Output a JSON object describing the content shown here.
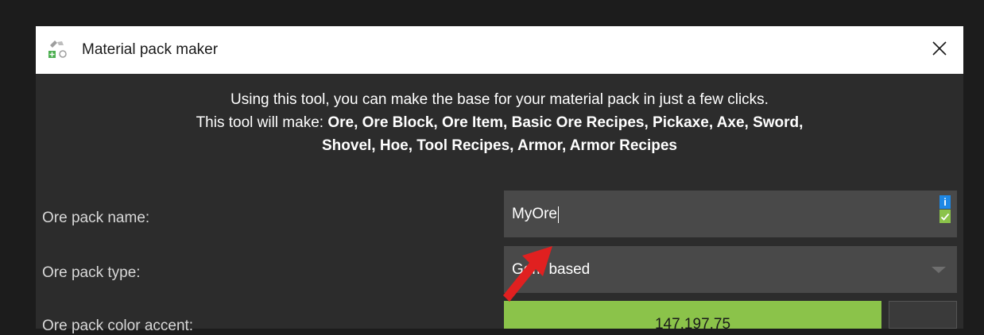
{
  "window": {
    "title": "Material pack maker"
  },
  "intro": {
    "line1": "Using this tool, you can make the base for your material pack in just a few clicks.",
    "line2_prefix": "This tool will make: ",
    "line2_bold": "Ore, Ore Block, Ore Item, Basic Ore Recipes, Pickaxe, Axe, Sword,",
    "line3_bold": "Shovel, Hoe, Tool Recipes, Armor, Armor Recipes"
  },
  "form": {
    "name": {
      "label": "Ore pack name:",
      "value": "MyOre"
    },
    "type": {
      "label": "Ore pack type:",
      "value": "Gem based"
    },
    "color": {
      "label": "Ore pack color accent:",
      "value": "147,197,75",
      "swatch": "#8bc34a"
    }
  },
  "badges": {
    "info": "i"
  },
  "icons": {
    "app": "material-pack-icon",
    "close": "close-icon",
    "info": "info-icon",
    "check": "check-icon",
    "dropdown": "chevron-down-icon",
    "annotation": "red-arrow-icon"
  },
  "colors": {
    "background": "#1c1c1c",
    "dialog": "#2c2c2c",
    "field": "#494949",
    "accent_green": "#8bc34a",
    "info_blue": "#1e88e5",
    "annotation_red": "#e02020"
  }
}
